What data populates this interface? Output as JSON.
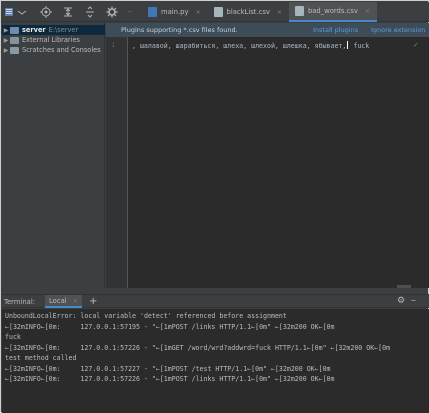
{
  "toolbar": {
    "icons": [
      "project-view-icon",
      "target-icon",
      "collapse-all-icon",
      "expand-icon",
      "gear-icon"
    ]
  },
  "tabs": [
    {
      "label": "main.py",
      "icon": "python-file-icon",
      "color": "#f5c342",
      "active": false
    },
    {
      "label": "blackList.csv",
      "icon": "csv-file-icon",
      "color": "#a7b5bd",
      "active": false
    },
    {
      "label": "bad_words.csv",
      "icon": "csv-file-icon",
      "color": "#a7b5bd",
      "active": true
    }
  ],
  "tree": {
    "root_name": "server",
    "root_path": "E:\\server",
    "external": "External Libraries",
    "scratches": "Scratches and Consoles"
  },
  "editor": {
    "notification": "Plugins supporting *.csv files found.",
    "install_link": "Install plugins",
    "ignore_link": "Ignore extension",
    "line_number": "1",
    "code_before_caret": ", шалавой, шарабиться, шлеха, шлехой, шлешка, ябывает,",
    "code_after_caret": " fuck"
  },
  "terminal": {
    "title": "Terminal:",
    "tab_label": "Local",
    "lines": [
      "UnboundLocalError: local variable 'detect' referenced before assignment",
      "←[32mINFO←[0m:     127.0.0.1:57195 - \"←[1mPOST /links HTTP/1.1←[0m\" ←[32m200 OK←[0m",
      "fuck",
      "←[32mINFO←[0m:     127.0.0.1:57226 - \"←[1mGET /word/wrd?addwrd=fuck HTTP/1.1←[0m\" ←[32m200 OK←[0m",
      "test method called",
      "←[32mINFO←[0m:     127.0.0.1:57227 - \"←[1mPOST /test HTTP/1.1←[0m\" ←[32m200 OK←[0m",
      "←[32mINFO←[0m:     127.0.0.1:57226 - \"←[1mPOST /links HTTP/1.1←[0m\" ←[32m200 OK←[0m"
    ]
  }
}
